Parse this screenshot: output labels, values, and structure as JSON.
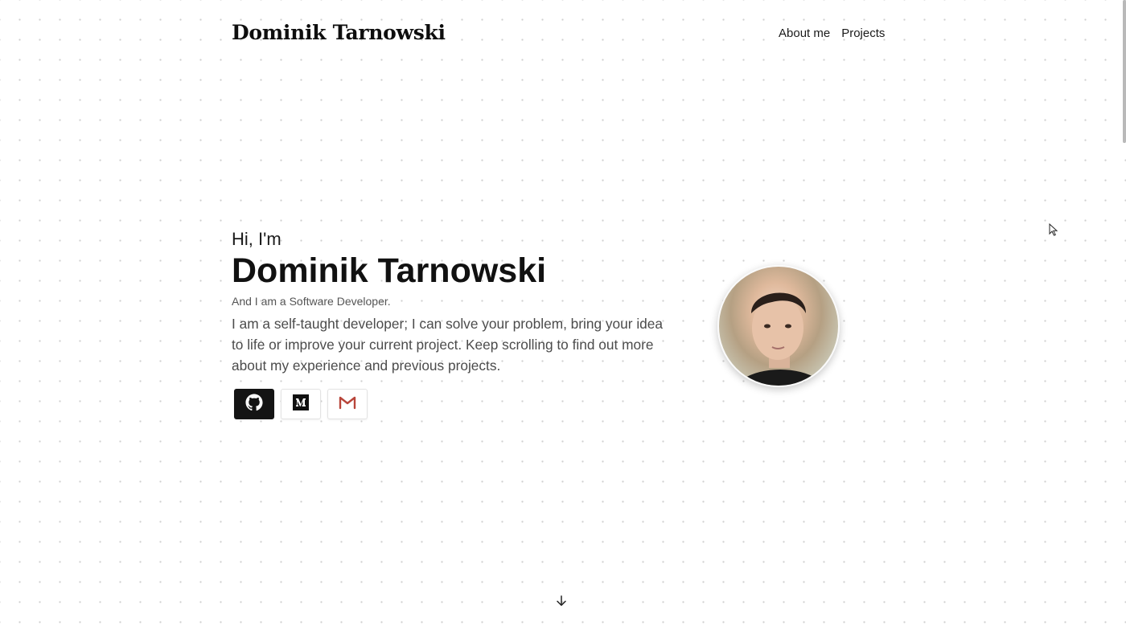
{
  "header": {
    "logo": "Dominik Tarnowski",
    "nav": [
      {
        "label": "About me"
      },
      {
        "label": "Projects"
      }
    ]
  },
  "hero": {
    "greeting": "Hi, I'm",
    "name": "Dominik Tarnowski",
    "role": "And I am a Software Developer.",
    "bio": "I am a self-taught developer; I can solve your problem, bring your idea to life or improve your current project. Keep scrolling to find out more about my experience and previous projects."
  },
  "social": [
    {
      "icon": "github-icon"
    },
    {
      "icon": "medium-icon"
    },
    {
      "icon": "gmail-icon"
    }
  ],
  "colors": {
    "text": "#141414",
    "muted": "#4b4b4b",
    "github_button": "#141414",
    "gmail_red": "#b8453a"
  }
}
